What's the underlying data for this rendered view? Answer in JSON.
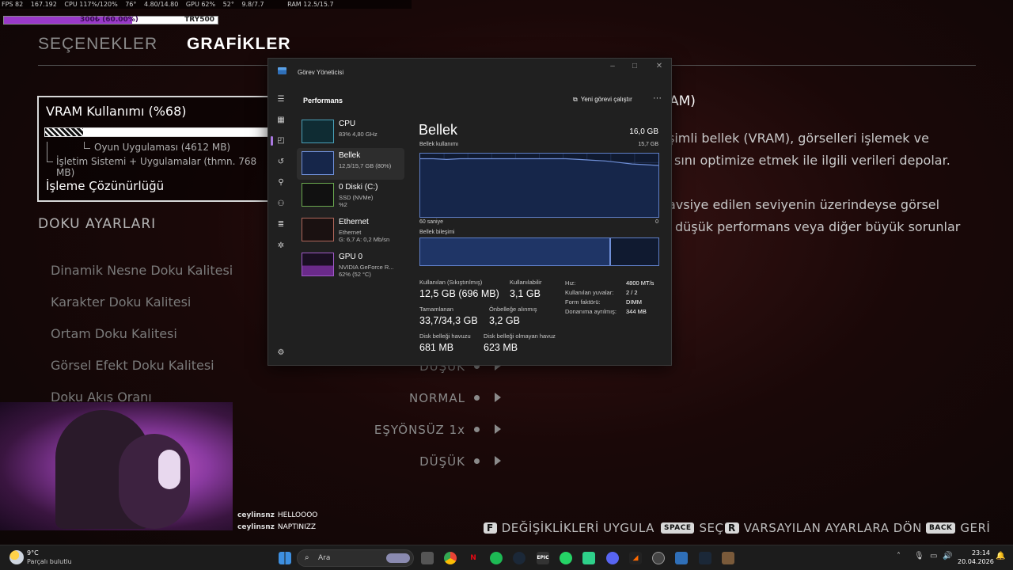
{
  "overlay": {
    "fps": "FPS 82",
    "fps2": "167.192",
    "cpu": "CPU 117%/120%",
    "cpu_temp": "76°",
    "cpu_clock": "4.80/14.80",
    "gpu": "GPU 62%",
    "gpu_temp": "52°",
    "gpu_mem": "9.8/7.7",
    "ram": "RAM 12.5/15.7",
    "budget_label": "300₺ (60.00%)",
    "budget_fraction": 0.6,
    "budget_right": "TRY500"
  },
  "menu": {
    "tab_options": "SEÇENEKLER",
    "tab_graphics": "GRAFİKLER",
    "vram_title": "VRAM Kullanımı (%68)",
    "vram_game": "Oyun Uygulaması (4612 MB)",
    "vram_os": "İşletim Sistemi + Uygulamalar (thmn. 768 MB)",
    "render_res": "İşleme Çözünürlüğü",
    "section": "DOKU AYARLARI",
    "settings": [
      "Dinamik Nesne Doku Kalitesi",
      "Karakter Doku Kalitesi",
      "Ortam Doku Kalitesi",
      "Görsel Efekt Doku Kalitesi",
      "Doku Akış Oranı"
    ],
    "values": [
      "DÜŞÜK",
      "NORMAL",
      "EŞYÖNSÜZ 1x",
      "DÜŞÜK"
    ],
    "desc_title_tail": "AM)",
    "desc_lines": [
      "şimli bellek (VRAM), görselleri işlemek ve",
      "sını optimize etmek ile ilgili verileri depolar.",
      "avsiye edilen seviyenin üzerindeyse görsel",
      "düşük performans veya diğer büyük sorunlar"
    ]
  },
  "hints": {
    "apply_key": "F",
    "apply": "DEĞİŞİKLİKLERİ UYGULA",
    "select_key": "SPACE",
    "select": "SEÇ",
    "reset_key": "R",
    "reset": "VARSAYILAN AYARLARA DÖN",
    "back_key": "BACK",
    "back": "GERİ"
  },
  "chat": [
    {
      "user": "ceylinsnz",
      "msg": "HELLOOOO"
    },
    {
      "user": "ceylinsnz",
      "msg": "NAPTINIZZ"
    }
  ],
  "taskmanager": {
    "title": "Görev Yöneticisi",
    "section": "Performans",
    "new_task": "Yeni görevi çalıştır",
    "more": "···",
    "items": [
      {
        "name": "CPU",
        "sub1": "83% 4,80 GHz",
        "sub2": ""
      },
      {
        "name": "Bellek",
        "sub1": "12,5/15,7 GB (80%)",
        "sub2": ""
      },
      {
        "name": "0 Diski (C:)",
        "sub1": "SSD (NVMe)",
        "sub2": "%2"
      },
      {
        "name": "Ethernet",
        "sub1": "Ethernet",
        "sub2": "G: 6,7 A: 0,2 Mb/sn"
      },
      {
        "name": "GPU 0",
        "sub1": "NVIDIA GeForce R...",
        "sub2": "62% (52 °C)"
      }
    ],
    "mem_title": "Bellek",
    "mem_total": "16,0 GB",
    "usage_label": "Bellek kullanımı",
    "usage_max": "15,7 GB",
    "axis_left": "60 saniye",
    "axis_right": "0",
    "composition_label": "Bellek bileşimi",
    "composition_fraction": 0.8,
    "usage_history": [
      0.8,
      0.8,
      0.79,
      0.8,
      0.8,
      0.8,
      0.8,
      0.8,
      0.8,
      0.8,
      0.8,
      0.8,
      0.79,
      0.78,
      0.77,
      0.75,
      0.73,
      0.72,
      0.71
    ],
    "stats": {
      "in_use_label": "Kullanılan (Sıkıştırılmış)",
      "in_use": "12,5 GB (696 MB)",
      "available_label": "Kullanılabilir",
      "available": "3,1 GB",
      "committed_label": "Tamamlanan",
      "committed": "33,7/34,3 GB",
      "cached_label": "Önbelleğe alınmış",
      "cached": "3,2 GB",
      "paged_label": "Disk belleği havuzu",
      "paged": "681 MB",
      "nonpaged_label": "Disk belleği olmayan havuz",
      "nonpaged": "623 MB"
    },
    "kv": [
      {
        "k": "Hız:",
        "v": "4800 MT/s"
      },
      {
        "k": "Kullanılan yuvalar:",
        "v": "2 / 2"
      },
      {
        "k": "Form faktörü:",
        "v": "DIMM"
      },
      {
        "k": "Donanıma ayrılmış:",
        "v": "344 MB"
      }
    ]
  },
  "taskbar": {
    "weather_temp": "9°C",
    "weather_desc": "Parçalı bulutlu",
    "search": "Ara",
    "time": "23:14",
    "date": "20.04.2026"
  },
  "colors": {
    "accent_purple": "#9a39c9",
    "graph_line": "#6f8fd8"
  }
}
